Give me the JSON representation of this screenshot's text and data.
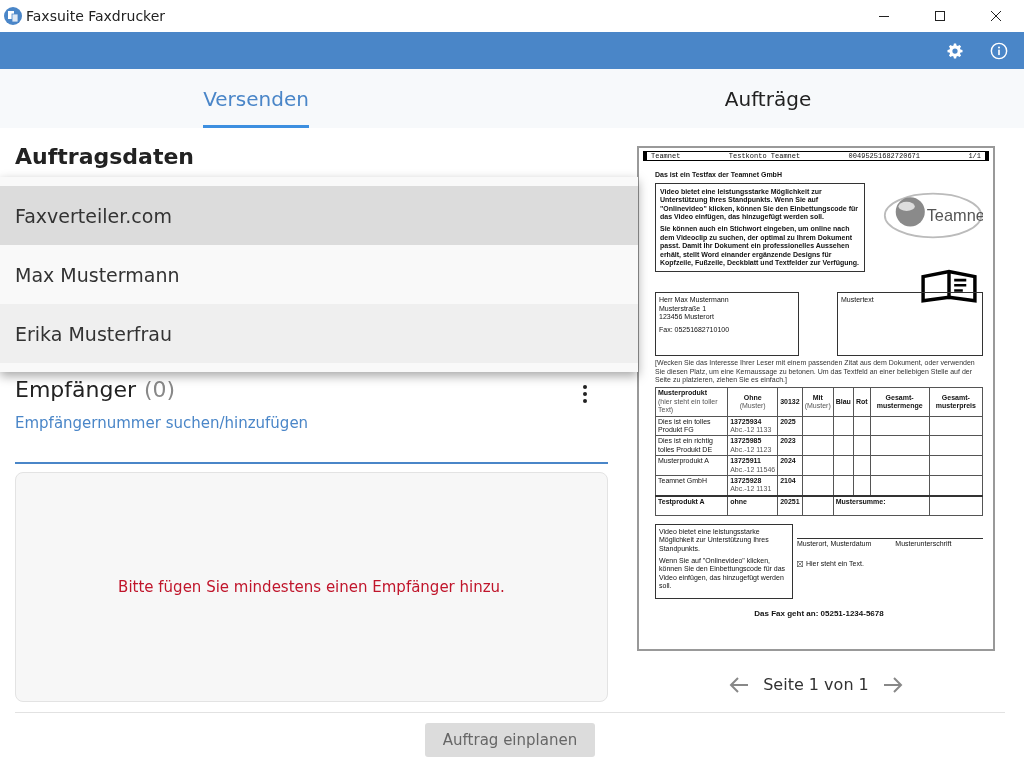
{
  "window": {
    "title": "Faxsuite Faxdrucker"
  },
  "tabs": [
    {
      "label": "Versenden",
      "selected": true
    },
    {
      "label": "Aufträge",
      "selected": false
    }
  ],
  "order": {
    "heading": "Auftragsdaten",
    "dropdown": [
      {
        "label": "Faxverteiler.com",
        "selected": true
      },
      {
        "label": "Max Mustermann",
        "selected": false
      },
      {
        "label": "Erika Musterfrau",
        "selected": false
      }
    ],
    "recipients_heading": "Empfänger",
    "recipients_count": "(0)",
    "add_link": "Empfängernummer suchen/hinzufügen",
    "empty_message": "Bitte fügen Sie mindestens einen Empfänger hinzu.",
    "submit": {
      "label": "Auftrag einplanen",
      "disabled": true
    }
  },
  "preview": {
    "page_label": "Seite 1 von 1",
    "fax": {
      "header": [
        "Teamnet",
        "Testkonto Teamnet",
        "00495251682720671",
        "1/1"
      ],
      "title": "Das ist ein Testfax der Teamnet GmbH",
      "intro": [
        "Video bietet eine leistungsstarke Möglichkeit zur Unterstützung Ihres Standpunkts. Wenn Sie auf \"Onlinevideo\" klicken, können Sie den Einbettungscode für das Video einfügen, das hinzugefügt werden soll.",
        "Sie können auch ein Stichwort eingeben, um online nach dem Videoclip zu suchen, der optimal zu Ihrem Dokument passt. Damit Ihr Dokument ein professionelles Aussehen erhält, stellt Word einander ergänzende Designs für Kopfzeile, Fußzeile, Deckblatt und Textfelder zur Verfügung."
      ],
      "logo_text": "Teamne",
      "address": [
        "Herr Max Mustermann",
        "Musterstraße 1",
        "123456 Musterort",
        "Fax: 052516827101​00"
      ],
      "side_box": "Mustertext",
      "note": "[Wecken Sie das Interesse Ihrer Leser mit einem passenden Zitat aus dem Dokument, oder verwenden Sie diesen Platz, um eine Kernaussage zu betonen. Um das Textfeld an einer beliebigen Stelle auf der Seite zu platzieren, ziehen Sie es einfach.]",
      "table": {
        "header": [
          {
            "text": "Musterprodukt",
            "sub": "(hier steht ein toller Text)"
          },
          {
            "text": "Ohne",
            "sub": "(Muster)"
          },
          {
            "text": "30132"
          },
          {
            "text": "Mit",
            "sub": "(Muster)"
          },
          {
            "text": "Blau"
          },
          {
            "text": "Rot"
          },
          {
            "text": "Gesamt-mustermenge"
          },
          {
            "text": "Gesamt-musterpreis"
          }
        ],
        "rows": [
          [
            {
              "text": "Dies ist ein tolles Produkt FG"
            },
            {
              "text": "13725934",
              "sub": "Abc.-12 1133"
            },
            {
              "text": "2025"
            }
          ],
          [
            {
              "text": "Dies ist ein richtig tolles Produkt DE"
            },
            {
              "text": "13725985",
              "sub": "Abc.-12 1123"
            },
            {
              "text": "2023"
            }
          ],
          [
            {
              "text": "Musterprodukt A"
            },
            {
              "text": "13725911",
              "sub": "Abc.-12 11546"
            },
            {
              "text": "2024"
            }
          ],
          [
            {
              "text": "Teamnet GmbH"
            },
            {
              "text": "13725928",
              "sub": "Abc.-12 1131"
            },
            {
              "text": "2104"
            }
          ]
        ],
        "total": [
          {
            "text": "Testprodukt A"
          },
          {
            "text": "ohne"
          },
          {
            "text": "20251"
          },
          {
            "text": "Mustersumme:"
          }
        ]
      },
      "footer_box": [
        "Video bietet eine leistungsstarke Möglichkeit zur Unterstützung Ihres Standpunkts.",
        "Wenn Sie auf \"Onlinevideo\" klicken, können Sie den Einbettungscode für das Video einfügen, das hinzugefügt werden soll."
      ],
      "signature": [
        "Musterort, Musterdatum",
        "Musterunterschrift"
      ],
      "checkbox_text": "Hier steht ein Text.",
      "checked": true,
      "destination": "Das Fax geht an: 05251-1234-5678"
    }
  }
}
